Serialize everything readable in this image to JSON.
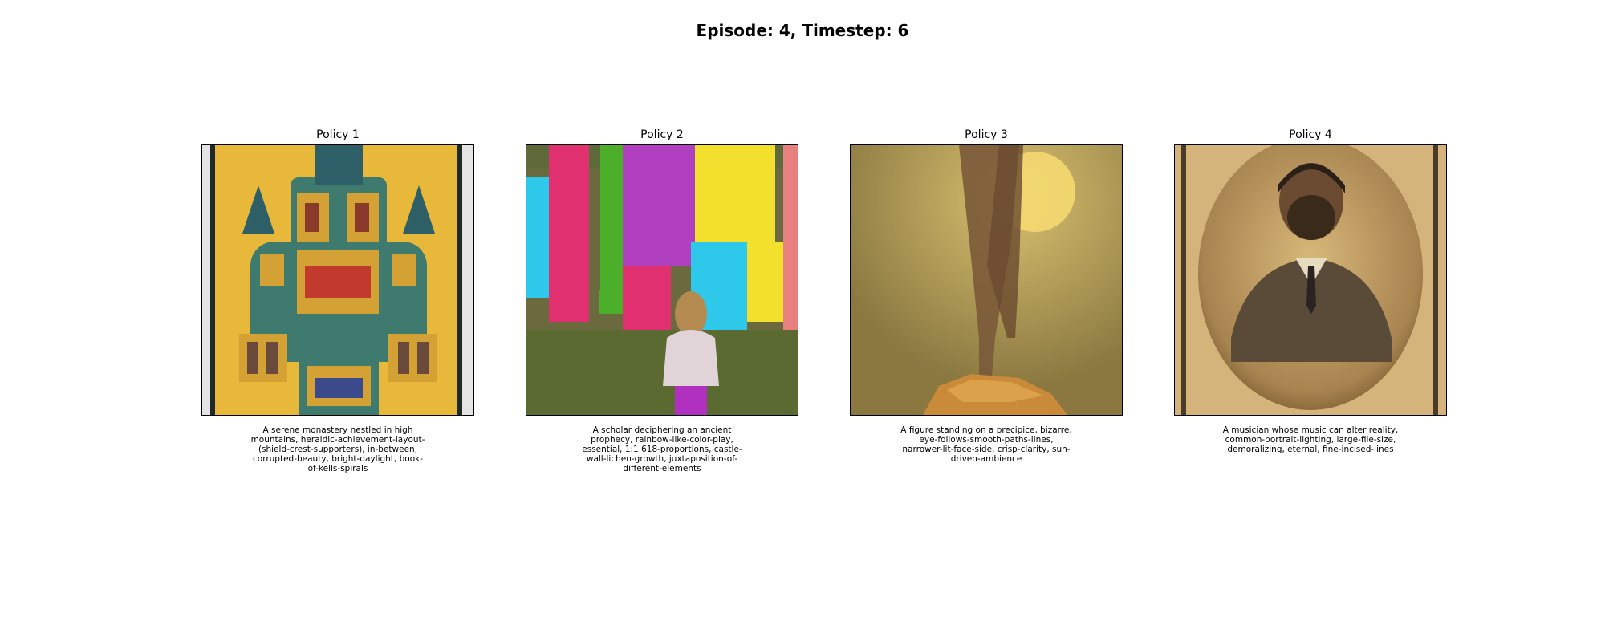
{
  "figure": {
    "title": "Episode: 4, Timestep: 6"
  },
  "panels": [
    {
      "title": "Policy 1",
      "caption": "A serene monastery nestled in high mountains, heraldic-achievement-layout-(shield-crest-supporters), in-between, corrupted-beauty, bright-daylight, book-of-kells-spirals",
      "palette": {
        "bg": "#e8b83a",
        "main": "#3f7a6e",
        "accent": "#c23a2e",
        "gold": "#d4a234"
      }
    },
    {
      "title": "Policy 2",
      "caption": "A scholar deciphering an ancient prophecy, rainbow-like-color-play, essential, 1:1.618-proportions, castle-wall-lichen-growth, juxtaposition-of-different-elements",
      "palette": {
        "wall": "#6b6a3e",
        "pink": "#e0306f",
        "green": "#4caf2a",
        "purple": "#b040c0",
        "yellow": "#f2e02c",
        "cyan": "#2ec8ea"
      }
    },
    {
      "title": "Policy 3",
      "caption": "A figure standing on a precipice, bizarre, eye-follows-smooth-paths-lines, narrower-lit-face-side, crisp-clarity, sun-driven-ambience",
      "palette": {
        "sky": "#a8904a",
        "sun": "#f5d870",
        "figure": "#7a5a38",
        "rock": "#c98a3a"
      }
    },
    {
      "title": "Policy 4",
      "caption": "A musician whose music can alter reality, common-portrait-lighting, large-file-size, demoralizing, eternal, fine-incised-lines",
      "palette": {
        "paper": "#d8b87a",
        "vignette": "#8a6a3a",
        "figure": "#4a3a28"
      }
    }
  ]
}
